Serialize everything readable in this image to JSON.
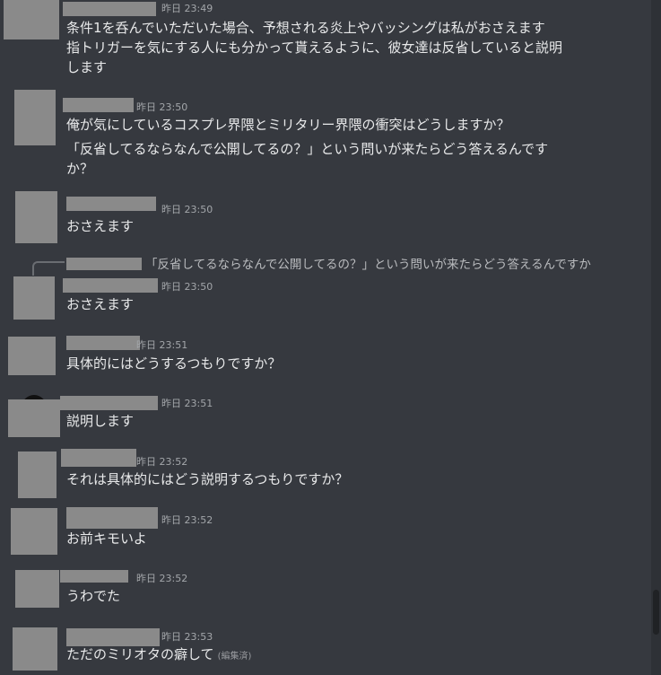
{
  "messages": [
    {
      "ts": "昨日 23:49",
      "lines": [
        "条件1を呑んでいただいた場合、予想される炎上やバッシングは私がおさえます",
        "指トリガーを気にする人にも分かって貰えるように、彼女達は反省していると説明",
        "します"
      ]
    },
    {
      "ts": "昨日 23:50",
      "lines": [
        "俺が気にしているコスプレ界隈とミリタリー界隈の衝突はどうしますか？",
        "「反省してるならなんで公開してるの？」という問いが来たらどう答えるんです",
        "か？"
      ]
    },
    {
      "ts": "昨日 23:50",
      "lines": [
        "おさえます"
      ]
    },
    {
      "reply": "「反省してるならなんで公開してるの？」という問いが来たらどう答えるんですか",
      "ts": "昨日 23:50",
      "lines": [
        "おさえます"
      ]
    },
    {
      "ts": "昨日 23:51",
      "lines": [
        "具体的にはどうするつもりですか？"
      ]
    },
    {
      "ts": "昨日 23:51",
      "lines": [
        "説明します"
      ]
    },
    {
      "ts": "昨日 23:52",
      "lines": [
        "それは具体的にはどう説明するつもりですか？"
      ]
    },
    {
      "ts": "昨日 23:52",
      "lines": [
        "お前キモいよ"
      ]
    },
    {
      "ts": "昨日 23:52",
      "lines": [
        "うわでた"
      ]
    },
    {
      "ts": "昨日 23:53",
      "lines": [
        "ただのミリオタの癖して"
      ],
      "edited": "(編集済)"
    }
  ]
}
